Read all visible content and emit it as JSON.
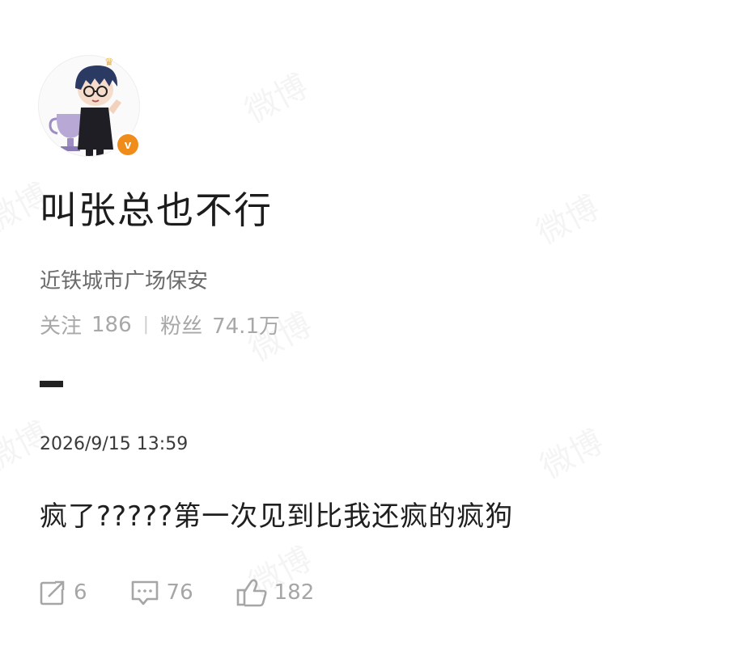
{
  "watermark_text": "微博",
  "profile": {
    "username": "叫张总也不行",
    "bio": "近铁城市广场保安",
    "following_label": "关注",
    "following_count": "186",
    "followers_label": "粉丝",
    "followers_count": "74.1万",
    "verified_badge": "v",
    "verified_color": "#f08c1a"
  },
  "post": {
    "timestamp": "2026/9/15 13:59",
    "text": "疯了?????第一次见到比我还疯的疯狗",
    "actions": {
      "share_count": "6",
      "comment_count": "76",
      "like_count": "182"
    }
  },
  "icons": [
    "avatar-image",
    "crown-icon",
    "verified-icon",
    "share-icon",
    "comment-icon",
    "like-icon"
  ]
}
